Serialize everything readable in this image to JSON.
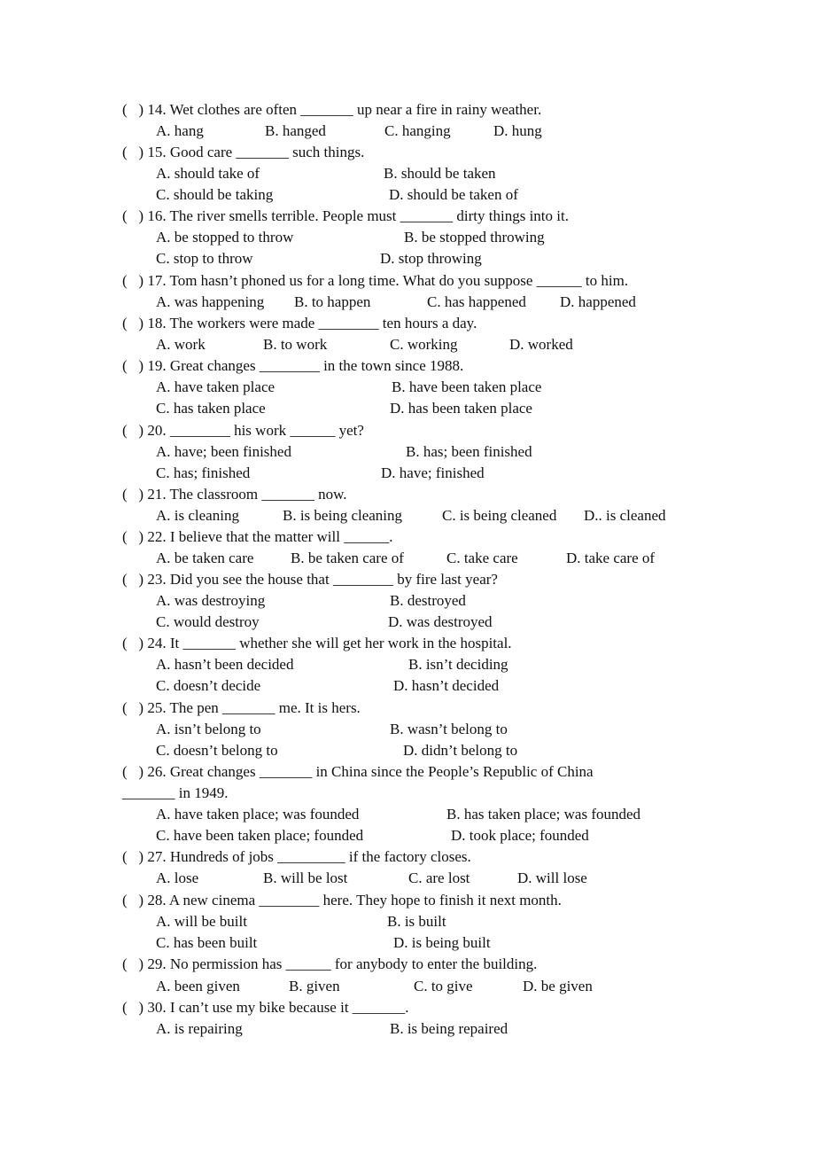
{
  "questions": [
    {
      "stem": "(   ) 14. Wet clothes are often _______ up near a fire in rainy weather.",
      "options": [
        "A. hang",
        "B. hanged",
        "C. hanging",
        "D. hung"
      ]
    },
    {
      "stem": "(   ) 15. Good care _______ such things.",
      "options": [
        "A. should take of",
        "B. should be taken",
        "C. should be taking",
        "D. should be taken of"
      ]
    },
    {
      "stem": "(   ) 16. The river smells terrible. People must _______ dirty things into it.",
      "options": [
        "A. be stopped to throw",
        "B. be stopped throwing",
        "C. stop to throw",
        "D. stop throwing"
      ]
    },
    {
      "stem": "(   ) 17. Tom hasn’t phoned us for a long time. What do you suppose ______ to him.",
      "options": [
        "A. was happening",
        "B. to happen",
        "C. has happened",
        "D. happened"
      ]
    },
    {
      "stem": "(   ) 18. The workers were made ________ ten hours a day.",
      "options": [
        "A. work",
        "B. to work",
        "C. working",
        "D. worked"
      ]
    },
    {
      "stem": "(   ) 19. Great changes ________ in the town since 1988.",
      "options": [
        "A. have taken place",
        "B. have been taken place",
        "C. has taken place",
        "D. has been taken place"
      ]
    },
    {
      "stem": "(   ) 20. ________ his work ______ yet?",
      "options": [
        "A. have; been finished",
        "B. has; been finished",
        "C. has; finished",
        "D. have; finished"
      ]
    },
    {
      "stem": "(   ) 21. The classroom _______ now.",
      "options": [
        "A. is cleaning",
        "B. is being cleaning",
        "C. is being cleaned",
        "D.. is cleaned"
      ]
    },
    {
      "stem": "(   ) 22. I believe that the matter will ______.",
      "options": [
        "A. be taken care",
        "B. be taken care of",
        "C. take care",
        "D. take care of"
      ]
    },
    {
      "stem": "(   ) 23. Did you see the house that ________ by fire last year?",
      "options": [
        "A. was destroying",
        "B. destroyed",
        "C. would destroy",
        "D. was destroyed"
      ]
    },
    {
      "stem": "(   ) 24. It _______ whether she will get her work in the hospital.",
      "options": [
        "A. hasn’t been decided",
        "B. isn’t deciding",
        "C. doesn’t decide",
        "D. hasn’t decided"
      ]
    },
    {
      "stem": "(   ) 25. The pen _______ me. It is hers.",
      "options": [
        "A. isn’t belong to",
        "B. wasn’t belong to",
        "C. doesn’t belong to",
        "D. didn’t belong to"
      ]
    },
    {
      "stem": "(   ) 26. Great changes _______ in China since the People’s Republic of China",
      "stem_cont": "_______ in 1949.",
      "options": [
        "A. have taken place; was founded",
        "B. has taken place; was founded",
        "C. have been taken place; founded",
        "D. took place; founded"
      ]
    },
    {
      "stem": "(   ) 27. Hundreds of jobs _________ if the factory closes.",
      "options": [
        "A. lose",
        "B. will be lost",
        "C. are lost",
        "D. will lose"
      ]
    },
    {
      "stem": "(   ) 28. A new cinema ________ here. They hope to finish it next month.",
      "options": [
        "A. will be built",
        "B. is built",
        "C. has been built",
        "D. is being built"
      ]
    },
    {
      "stem": "(   ) 29. No permission has ______ for anybody to enter the building.",
      "options": [
        "A. been given",
        "B. given",
        "C. to give",
        "D. be given"
      ]
    },
    {
      "stem": "(   ) 30. I can’t use my bike because it _______.",
      "options": [
        "A. is repairing",
        "B. is being repaired"
      ]
    }
  ]
}
